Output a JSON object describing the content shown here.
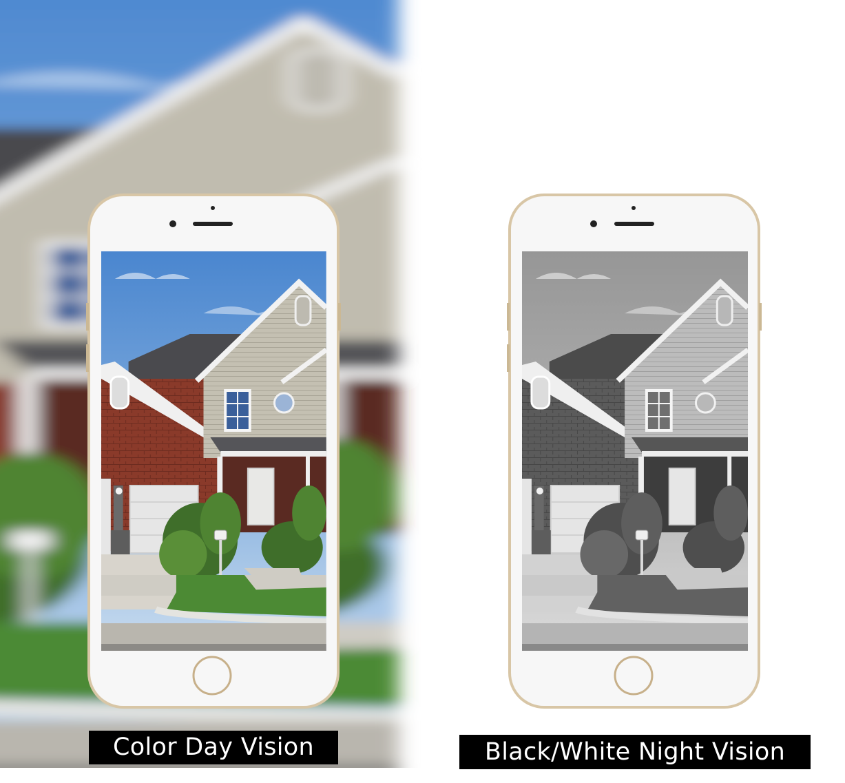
{
  "captions": {
    "left": "Color Day Vision",
    "right": "Black/White Night Vision"
  },
  "palette": {
    "sky_blue": "#7aa6d8",
    "brick_red": "#8a3a2a",
    "siding_beige": "#bfbcae",
    "roof_gray": "#4a4a4e",
    "lawn_green": "#4c8a34",
    "bush_green": "#3f6e2a",
    "garage_white": "#e6e6e6",
    "phone_gold": "#d8c6a6",
    "phone_white": "#f7f7f7"
  },
  "icons": {
    "phone_left": [
      "earpiece-icon",
      "front-camera-icon",
      "home-button-icon"
    ],
    "phone_right": [
      "earpiece-icon",
      "front-camera-icon",
      "home-button-icon"
    ]
  }
}
